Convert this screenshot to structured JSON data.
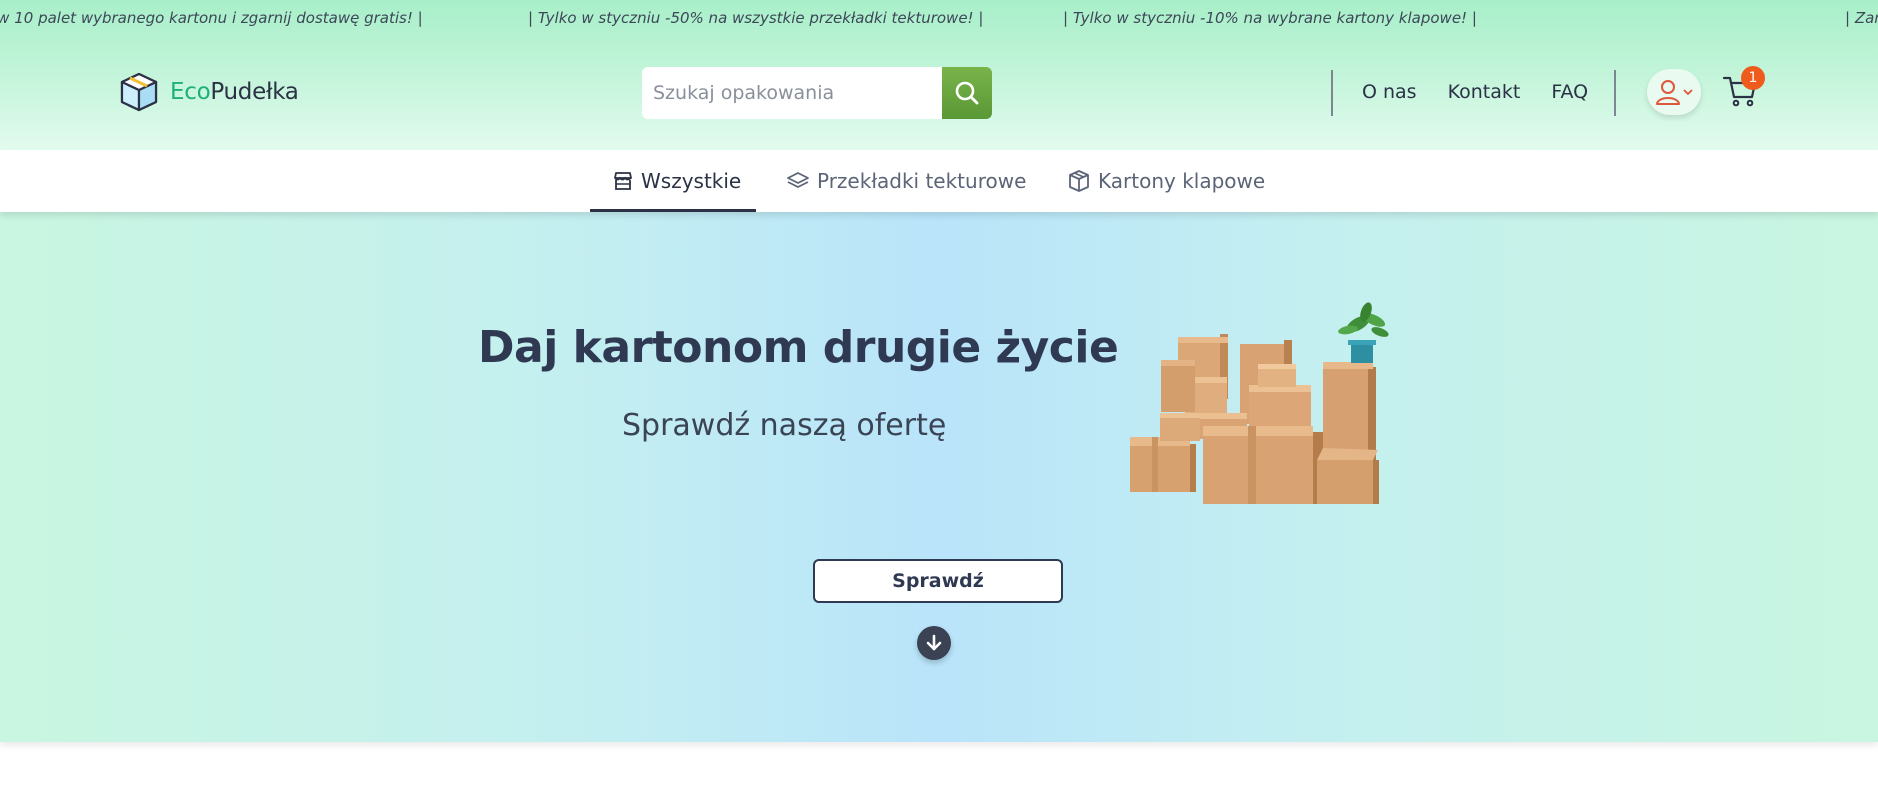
{
  "ticker": {
    "items": [
      "ów 10 palet wybranego kartonu i zgarnij dostawę gratis! |",
      "| Tylko w styczniu -50% na wszystkie przekładki tekturowe! |",
      "| Tylko w styczniu -10% na wybrane kartony klapowe! |",
      "| Zam"
    ]
  },
  "header": {
    "logo_eco": "Eco",
    "logo_rest": "Pudełka",
    "search_placeholder": "Szukaj opakowania",
    "links": [
      "O nas",
      "Kontakt",
      "FAQ"
    ],
    "cart_count": "1",
    "icons": [
      "box-logo-icon",
      "search-icon",
      "user-icon",
      "chevron-down-icon",
      "cart-icon"
    ]
  },
  "tabs": [
    {
      "label": "Wszystkie",
      "icon": "store-icon",
      "active": true
    },
    {
      "label": "Przekładki tekturowe",
      "icon": "layers-icon",
      "active": false
    },
    {
      "label": "Kartony klapowe",
      "icon": "box-icon",
      "active": false
    }
  ],
  "hero": {
    "title": "Daj kartonom drugie życie",
    "subtitle": "Sprawdź naszą ofertę",
    "button": "Sprawdź",
    "image": "cardboard-boxes-with-plant"
  },
  "colors": {
    "brand_green": "#1fb07a",
    "search_button": "#6aa83f",
    "text_dark": "#2b3246",
    "badge": "#ef5a1d",
    "user_icon": "#e0563b"
  }
}
